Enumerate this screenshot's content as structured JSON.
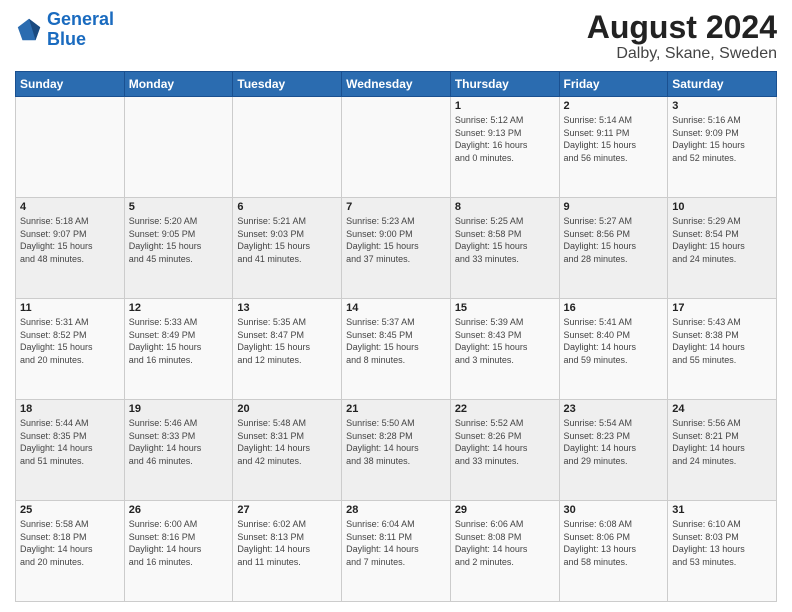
{
  "header": {
    "logo_text_general": "General",
    "logo_text_blue": "Blue",
    "main_title": "August 2024",
    "subtitle": "Dalby, Skane, Sweden"
  },
  "days_of_week": [
    "Sunday",
    "Monday",
    "Tuesday",
    "Wednesday",
    "Thursday",
    "Friday",
    "Saturday"
  ],
  "weeks": [
    [
      {
        "day": "",
        "info": ""
      },
      {
        "day": "",
        "info": ""
      },
      {
        "day": "",
        "info": ""
      },
      {
        "day": "",
        "info": ""
      },
      {
        "day": "1",
        "info": "Sunrise: 5:12 AM\nSunset: 9:13 PM\nDaylight: 16 hours\nand 0 minutes."
      },
      {
        "day": "2",
        "info": "Sunrise: 5:14 AM\nSunset: 9:11 PM\nDaylight: 15 hours\nand 56 minutes."
      },
      {
        "day": "3",
        "info": "Sunrise: 5:16 AM\nSunset: 9:09 PM\nDaylight: 15 hours\nand 52 minutes."
      }
    ],
    [
      {
        "day": "4",
        "info": "Sunrise: 5:18 AM\nSunset: 9:07 PM\nDaylight: 15 hours\nand 48 minutes."
      },
      {
        "day": "5",
        "info": "Sunrise: 5:20 AM\nSunset: 9:05 PM\nDaylight: 15 hours\nand 45 minutes."
      },
      {
        "day": "6",
        "info": "Sunrise: 5:21 AM\nSunset: 9:03 PM\nDaylight: 15 hours\nand 41 minutes."
      },
      {
        "day": "7",
        "info": "Sunrise: 5:23 AM\nSunset: 9:00 PM\nDaylight: 15 hours\nand 37 minutes."
      },
      {
        "day": "8",
        "info": "Sunrise: 5:25 AM\nSunset: 8:58 PM\nDaylight: 15 hours\nand 33 minutes."
      },
      {
        "day": "9",
        "info": "Sunrise: 5:27 AM\nSunset: 8:56 PM\nDaylight: 15 hours\nand 28 minutes."
      },
      {
        "day": "10",
        "info": "Sunrise: 5:29 AM\nSunset: 8:54 PM\nDaylight: 15 hours\nand 24 minutes."
      }
    ],
    [
      {
        "day": "11",
        "info": "Sunrise: 5:31 AM\nSunset: 8:52 PM\nDaylight: 15 hours\nand 20 minutes."
      },
      {
        "day": "12",
        "info": "Sunrise: 5:33 AM\nSunset: 8:49 PM\nDaylight: 15 hours\nand 16 minutes."
      },
      {
        "day": "13",
        "info": "Sunrise: 5:35 AM\nSunset: 8:47 PM\nDaylight: 15 hours\nand 12 minutes."
      },
      {
        "day": "14",
        "info": "Sunrise: 5:37 AM\nSunset: 8:45 PM\nDaylight: 15 hours\nand 8 minutes."
      },
      {
        "day": "15",
        "info": "Sunrise: 5:39 AM\nSunset: 8:43 PM\nDaylight: 15 hours\nand 3 minutes."
      },
      {
        "day": "16",
        "info": "Sunrise: 5:41 AM\nSunset: 8:40 PM\nDaylight: 14 hours\nand 59 minutes."
      },
      {
        "day": "17",
        "info": "Sunrise: 5:43 AM\nSunset: 8:38 PM\nDaylight: 14 hours\nand 55 minutes."
      }
    ],
    [
      {
        "day": "18",
        "info": "Sunrise: 5:44 AM\nSunset: 8:35 PM\nDaylight: 14 hours\nand 51 minutes."
      },
      {
        "day": "19",
        "info": "Sunrise: 5:46 AM\nSunset: 8:33 PM\nDaylight: 14 hours\nand 46 minutes."
      },
      {
        "day": "20",
        "info": "Sunrise: 5:48 AM\nSunset: 8:31 PM\nDaylight: 14 hours\nand 42 minutes."
      },
      {
        "day": "21",
        "info": "Sunrise: 5:50 AM\nSunset: 8:28 PM\nDaylight: 14 hours\nand 38 minutes."
      },
      {
        "day": "22",
        "info": "Sunrise: 5:52 AM\nSunset: 8:26 PM\nDaylight: 14 hours\nand 33 minutes."
      },
      {
        "day": "23",
        "info": "Sunrise: 5:54 AM\nSunset: 8:23 PM\nDaylight: 14 hours\nand 29 minutes."
      },
      {
        "day": "24",
        "info": "Sunrise: 5:56 AM\nSunset: 8:21 PM\nDaylight: 14 hours\nand 24 minutes."
      }
    ],
    [
      {
        "day": "25",
        "info": "Sunrise: 5:58 AM\nSunset: 8:18 PM\nDaylight: 14 hours\nand 20 minutes."
      },
      {
        "day": "26",
        "info": "Sunrise: 6:00 AM\nSunset: 8:16 PM\nDaylight: 14 hours\nand 16 minutes."
      },
      {
        "day": "27",
        "info": "Sunrise: 6:02 AM\nSunset: 8:13 PM\nDaylight: 14 hours\nand 11 minutes."
      },
      {
        "day": "28",
        "info": "Sunrise: 6:04 AM\nSunset: 8:11 PM\nDaylight: 14 hours\nand 7 minutes."
      },
      {
        "day": "29",
        "info": "Sunrise: 6:06 AM\nSunset: 8:08 PM\nDaylight: 14 hours\nand 2 minutes."
      },
      {
        "day": "30",
        "info": "Sunrise: 6:08 AM\nSunset: 8:06 PM\nDaylight: 13 hours\nand 58 minutes."
      },
      {
        "day": "31",
        "info": "Sunrise: 6:10 AM\nSunset: 8:03 PM\nDaylight: 13 hours\nand 53 minutes."
      }
    ]
  ]
}
